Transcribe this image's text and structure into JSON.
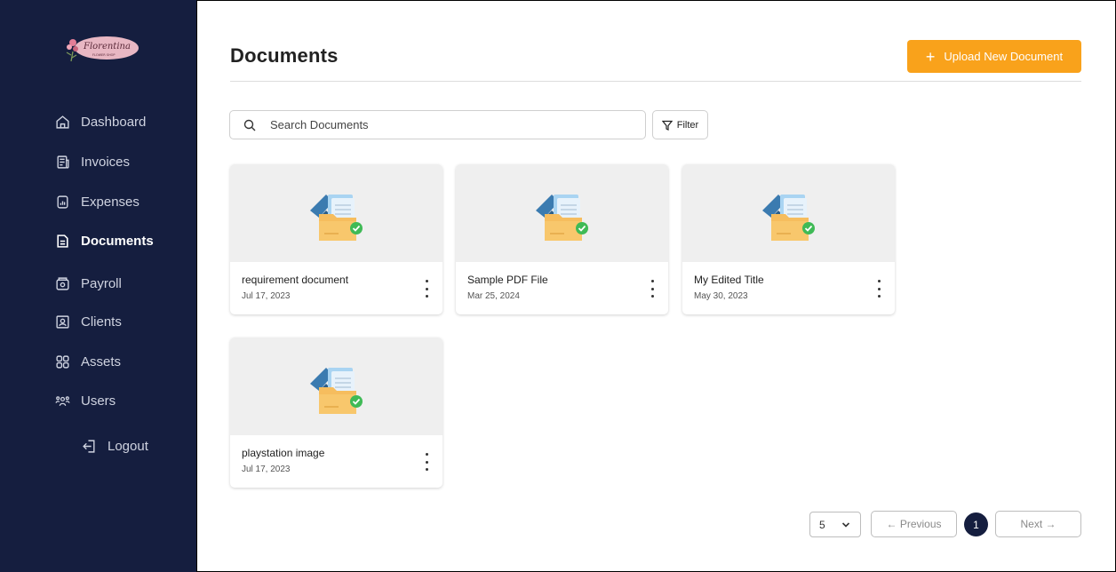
{
  "sidebar": {
    "logo_text": "Florentina",
    "logo_subtext": "FLOWER SHOP",
    "items": [
      {
        "label": "Dashboard",
        "icon": "home-icon"
      },
      {
        "label": "Invoices",
        "icon": "invoice-icon"
      },
      {
        "label": "Expenses",
        "icon": "expenses-icon"
      },
      {
        "label": "Documents",
        "icon": "document-icon",
        "active": true
      },
      {
        "label": "Payroll",
        "icon": "payroll-icon"
      },
      {
        "label": "Clients",
        "icon": "clients-icon"
      },
      {
        "label": "Assets",
        "icon": "assets-icon"
      },
      {
        "label": "Users",
        "icon": "users-icon"
      }
    ],
    "logout_label": "Logout"
  },
  "header": {
    "title": "Documents",
    "upload_label": "Upload New Document"
  },
  "search": {
    "placeholder": "Search Documents",
    "value": ""
  },
  "filter_label": "Filter",
  "documents": [
    {
      "title": "requirement document",
      "date": "Jul 17, 2023"
    },
    {
      "title": "Sample PDF File",
      "date": "Mar 25, 2024"
    },
    {
      "title": "My Edited Title",
      "date": "May 30, 2023"
    },
    {
      "title": "playstation image",
      "date": "Jul 17, 2023"
    }
  ],
  "pagination": {
    "page_size": "5",
    "previous_label": "← Previous",
    "current_page": "1",
    "next_label": "Next →"
  },
  "colors": {
    "sidebar_bg": "#151e3f",
    "accent": "#f9a21b",
    "thumb_bg": "#efefef"
  }
}
